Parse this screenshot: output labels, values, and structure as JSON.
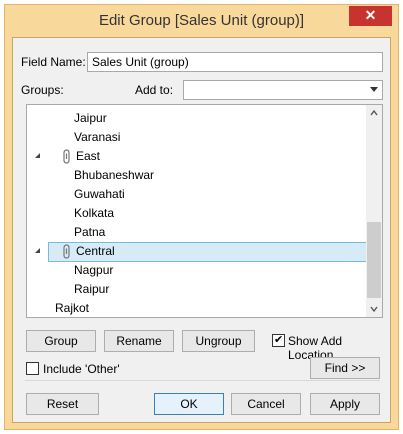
{
  "window": {
    "title": "Edit Group [Sales Unit (group)]",
    "close_glyph": "✕"
  },
  "field_name": {
    "label": "Field Name:",
    "value": "Sales Unit (group)"
  },
  "groups_label": "Groups:",
  "add_to": {
    "label": "Add to:",
    "value": ""
  },
  "tree": {
    "items": [
      {
        "label": "Jaipur",
        "level": "child"
      },
      {
        "label": "Varanasi",
        "level": "child"
      },
      {
        "label": "East",
        "level": "group",
        "expanded": true
      },
      {
        "label": "Bhubaneshwar",
        "level": "child"
      },
      {
        "label": "Guwahati",
        "level": "child"
      },
      {
        "label": "Kolkata",
        "level": "child"
      },
      {
        "label": "Patna",
        "level": "child"
      },
      {
        "label": "Central",
        "level": "group",
        "expanded": true,
        "selected": true
      },
      {
        "label": "Nagpur",
        "level": "child"
      },
      {
        "label": "Raipur",
        "level": "child"
      },
      {
        "label": "Rajkot",
        "level": "ungrouped"
      }
    ]
  },
  "buttons": {
    "group": "Group",
    "rename": "Rename",
    "ungroup": "Ungroup",
    "find": "Find >>",
    "reset": "Reset",
    "ok": "OK",
    "cancel": "Cancel",
    "apply": "Apply"
  },
  "show_add_location": {
    "label": "Show Add Location",
    "checked": true
  },
  "include_other": {
    "label": "Include 'Other'",
    "checked": false
  },
  "colors": {
    "frame": "#f9d89c",
    "close_button": "#c7332f",
    "selection_fill": "#d7ebf7",
    "selection_border": "#79b9dd"
  }
}
